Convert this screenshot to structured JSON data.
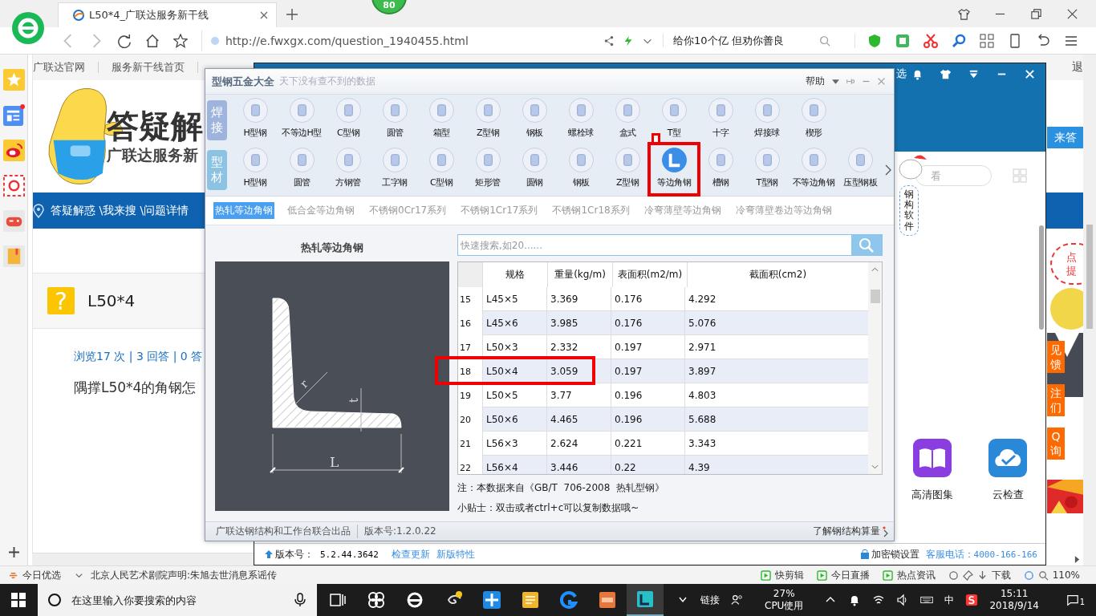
{
  "browser": {
    "badge": "80",
    "tabs": [
      {
        "title": "L50*4_广联达服务新干线",
        "selected": true
      }
    ],
    "url": "http://e.fwxgx.com/question_1940455.html",
    "search_placeholder": "给你10个亿 但劝你善良"
  },
  "page": {
    "nav": [
      "广联达官网",
      "服务新干线首页"
    ],
    "logo_title": "答疑解",
    "logo_subtitle": "广联达服务新",
    "breadcrumb": "答疑解惑 \\我来搜 \\问题详情",
    "question_mark": "?",
    "question_title": "L50*4",
    "stats": "浏览17 次 | 3 回答 | 0 答",
    "question_text": "隅撑L50*4的角钢怎",
    "top_link": "退",
    "answer_button": "来答",
    "bubble_lines": [
      "点",
      "提"
    ],
    "side_tabs": [
      "见馈",
      "注们",
      "Q询"
    ]
  },
  "app_window": {
    "header_text": "选",
    "search_placeholder": "看",
    "mascot_label": "钢构软件",
    "apps": [
      "高清图集",
      "云检查"
    ],
    "version_label": "版本号：",
    "version": "5.2.44.3642",
    "links": [
      "检查更新",
      "新版特性"
    ],
    "lock": "加密锁设置",
    "hotline_label": "客服电话：",
    "hotline": "4000-166-166"
  },
  "dialog": {
    "title": "型钢五金大全",
    "subtitle": "天下没有查不到的数据",
    "help": "帮助",
    "groups": [
      {
        "label": "焊接",
        "items": [
          {
            "label": "H型钢",
            "selected": false,
            "marked": false
          },
          {
            "label": "不等边H型",
            "selected": false,
            "marked": false
          },
          {
            "label": "C型钢",
            "selected": false,
            "marked": false
          },
          {
            "label": "圆管",
            "selected": false,
            "marked": false
          },
          {
            "label": "箱型",
            "selected": false,
            "marked": false
          },
          {
            "label": "Z型钢",
            "selected": false,
            "marked": false
          },
          {
            "label": "钢板",
            "selected": false,
            "marked": false
          },
          {
            "label": "螺栓球",
            "selected": false,
            "marked": false
          },
          {
            "label": "盒式",
            "selected": false,
            "marked": false
          },
          {
            "label": "T型",
            "selected": false,
            "marked": false
          },
          {
            "label": "十字",
            "selected": false,
            "marked": false
          },
          {
            "label": "焊接球",
            "selected": false,
            "marked": false
          },
          {
            "label": "楔形",
            "selected": false,
            "marked": false
          }
        ]
      },
      {
        "label": "型材",
        "items": [
          {
            "label": "H型钢",
            "selected": false,
            "marked": false
          },
          {
            "label": "圆管",
            "selected": false,
            "marked": false
          },
          {
            "label": "方钢管",
            "selected": false,
            "marked": false
          },
          {
            "label": "工字钢",
            "selected": false,
            "marked": false
          },
          {
            "label": "C型钢",
            "selected": false,
            "marked": false
          },
          {
            "label": "矩形管",
            "selected": false,
            "marked": false
          },
          {
            "label": "圆钢",
            "selected": false,
            "marked": false
          },
          {
            "label": "钢板",
            "selected": false,
            "marked": false
          },
          {
            "label": "Z型钢",
            "selected": false,
            "marked": false
          },
          {
            "label": "等边角钢",
            "selected": true,
            "marked": true
          },
          {
            "label": "槽钢",
            "selected": false,
            "marked": false
          },
          {
            "label": "T型钢",
            "selected": false,
            "marked": false
          },
          {
            "label": "不等边角钢",
            "selected": false,
            "marked": false
          },
          {
            "label": "压型钢板",
            "selected": false,
            "marked": false
          }
        ]
      }
    ],
    "subtabs": [
      {
        "label": "热轧等边角钢",
        "selected": true
      },
      {
        "label": "低合金等边角钢",
        "selected": false
      },
      {
        "label": "不锈钢0Cr17系列",
        "selected": false
      },
      {
        "label": "不锈钢1Cr17系列",
        "selected": false
      },
      {
        "label": "不锈钢1Cr18系列",
        "selected": false
      },
      {
        "label": "冷弯薄壁等边角钢",
        "selected": false
      },
      {
        "label": "冷弯薄壁卷边等边角钢",
        "selected": false
      }
    ],
    "section_title": "热轧等边角钢",
    "dimension_labels": [
      "r",
      "t",
      "L"
    ],
    "search_placeholder": "快速搜索,如20......",
    "columns": [
      "规格",
      "重量(kg/m)",
      "表面积(m2/m)",
      "截面积(cm2)"
    ],
    "rows": [
      {
        "no": "15",
        "cells": [
          "L45×5",
          "3.369",
          "0.176",
          "4.292"
        ],
        "marked": false
      },
      {
        "no": "16",
        "cells": [
          "L45×6",
          "3.985",
          "0.176",
          "5.076"
        ],
        "marked": false
      },
      {
        "no": "17",
        "cells": [
          "L50×3",
          "2.332",
          "0.197",
          "2.971"
        ],
        "marked": false
      },
      {
        "no": "18",
        "cells": [
          "L50×4",
          "3.059",
          "0.197",
          "3.897"
        ],
        "marked": true
      },
      {
        "no": "19",
        "cells": [
          "L50×5",
          "3.77",
          "0.196",
          "4.803"
        ],
        "marked": false
      },
      {
        "no": "20",
        "cells": [
          "L50×6",
          "4.465",
          "0.196",
          "5.688"
        ],
        "marked": false
      },
      {
        "no": "21",
        "cells": [
          "L56×3",
          "2.624",
          "0.221",
          "3.343"
        ],
        "marked": false
      },
      {
        "no": "22",
        "cells": [
          "L56×4",
          "3.446",
          "0.22",
          "4.39"
        ],
        "marked": false
      }
    ],
    "notes": [
      "注：本数据来自《GB/T  706-2008  热轧型钢》",
      "小贴士：双击或者ctrl+c可以复制数据哦~"
    ],
    "footer_left": "广联达钢结构和工作台联合出品",
    "footer_version": "版本号:1.2.0.22",
    "footer_link": "了解钢结构算量"
  },
  "status_bar": {
    "left": "今日优选",
    "news": "北京人民艺术剧院声明:朱旭去世消息系谣传",
    "items": [
      "快剪辑",
      "今日直播",
      "热点资讯"
    ],
    "download": "下载",
    "zoom": "110%"
  },
  "taskbar": {
    "search_placeholder": "在这里输入你要搜索的内容",
    "links": "链接",
    "cpu_percent": "27%",
    "cpu_label": "CPU使用",
    "ime": "中",
    "time": "15:11",
    "date": "2018/9/14",
    "notifications": "1"
  }
}
